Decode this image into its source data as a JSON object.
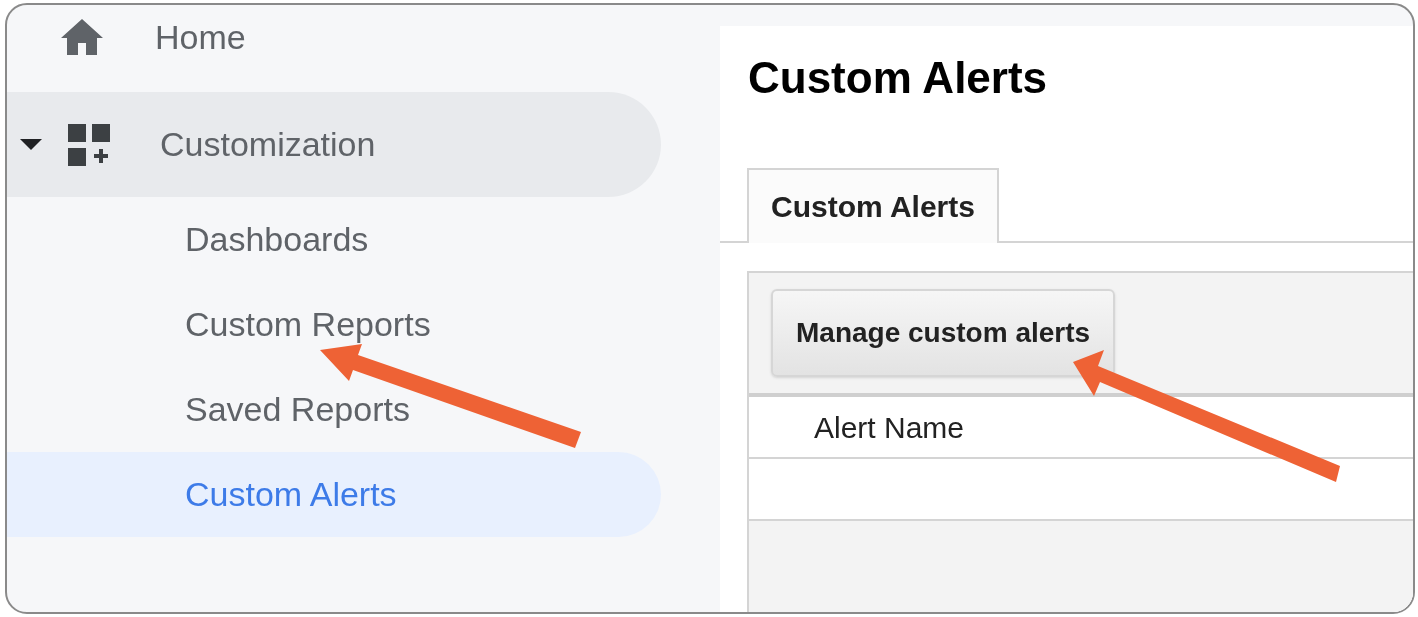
{
  "sidebar": {
    "items": [
      {
        "label": "Home"
      },
      {
        "label": "Customization",
        "expanded": true,
        "children": [
          {
            "label": "Dashboards",
            "selected": false
          },
          {
            "label": "Custom Reports",
            "selected": false
          },
          {
            "label": "Saved Reports",
            "selected": false
          },
          {
            "label": "Custom Alerts",
            "selected": true
          }
        ]
      }
    ]
  },
  "main": {
    "title": "Custom Alerts",
    "tabs": [
      {
        "label": "Custom Alerts",
        "selected": true
      }
    ],
    "toolbar": {
      "buttons": [
        "Manage custom alerts"
      ]
    },
    "table": {
      "columns": [
        "Alert Name"
      ]
    }
  }
}
